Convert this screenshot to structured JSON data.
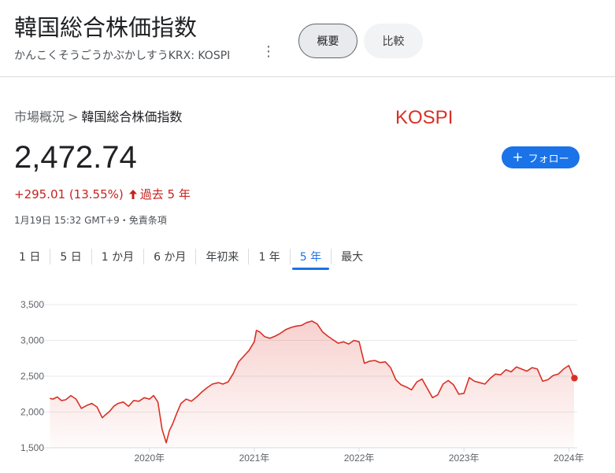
{
  "header": {
    "title": "韓国総合株価指数",
    "subtitle": "かんこくそうごうかぶかしすうKRX: KOSPI",
    "more_icon": "⋮",
    "chips": {
      "overview": "概要",
      "compare": "比較"
    }
  },
  "breadcrumb": {
    "parent": "市場概況",
    "separator": ">",
    "current": "韓国総合株価指数"
  },
  "ticker_label": "KOSPI",
  "quote": {
    "price": "2,472.74",
    "change": "+295.01 (13.55%)",
    "period": "過去 5 年",
    "meta": "1月19日 15:32 GMT+9・免責条項",
    "follow_label": "フォロー",
    "follow_icon": "+"
  },
  "ranges": [
    "1 日",
    "5 日",
    "1 か月",
    "6 か月",
    "年初来",
    "1 年",
    "5 年",
    "最大"
  ],
  "active_range": "5 年",
  "colors": {
    "line": "#d93025",
    "accent": "#1a73e8",
    "negative": "#c5221f"
  },
  "chart_data": {
    "type": "area",
    "y_ticks": [
      "3,500",
      "3,000",
      "2,500",
      "2,000",
      "1,500"
    ],
    "y_tick_values": [
      3500,
      3000,
      2500,
      2000,
      1500
    ],
    "x_ticks": [
      "2020年",
      "2021年",
      "2022年",
      "2023年",
      "2024年"
    ],
    "x_tick_values": [
      2020.0,
      2021.0,
      2022.0,
      2023.0,
      2024.0
    ],
    "ylim": [
      1500,
      3500
    ],
    "xlim": [
      2019.04,
      2024.08
    ],
    "grid": true,
    "series": [
      {
        "x": [
          2019.05,
          2019.08,
          2019.12,
          2019.16,
          2019.2,
          2019.25,
          2019.3,
          2019.35,
          2019.4,
          2019.45,
          2019.5,
          2019.55,
          2019.58,
          2019.62,
          2019.66,
          2019.7,
          2019.75,
          2019.8,
          2019.85,
          2019.9,
          2019.95,
          2020.0,
          2020.04,
          2020.08,
          2020.12,
          2020.16,
          2020.19,
          2020.22,
          2020.26,
          2020.3,
          2020.35,
          2020.4,
          2020.45,
          2020.5,
          2020.55,
          2020.6,
          2020.66,
          2020.7,
          2020.75,
          2020.8,
          2020.85,
          2020.9,
          2020.95,
          2021.0,
          2021.02,
          2021.05,
          2021.1,
          2021.15,
          2021.2,
          2021.25,
          2021.3,
          2021.35,
          2021.4,
          2021.45,
          2021.5,
          2021.55,
          2021.6,
          2021.65,
          2021.7,
          2021.75,
          2021.8,
          2021.85,
          2021.9,
          2021.95,
          2022.0,
          2022.05,
          2022.1,
          2022.15,
          2022.2,
          2022.25,
          2022.3,
          2022.35,
          2022.4,
          2022.45,
          2022.5,
          2022.55,
          2022.6,
          2022.65,
          2022.7,
          2022.75,
          2022.8,
          2022.85,
          2022.9,
          2022.95,
          2023.0,
          2023.05,
          2023.1,
          2023.15,
          2023.2,
          2023.25,
          2023.3,
          2023.35,
          2023.4,
          2023.45,
          2023.5,
          2023.55,
          2023.6,
          2023.65,
          2023.7,
          2023.75,
          2023.8,
          2023.85,
          2023.9,
          2023.95,
          2024.0,
          2024.02,
          2024.05
        ],
        "y": [
          2190,
          2180,
          2210,
          2160,
          2170,
          2230,
          2180,
          2050,
          2090,
          2120,
          2070,
          1920,
          1960,
          2010,
          2080,
          2120,
          2140,
          2080,
          2160,
          2150,
          2200,
          2180,
          2230,
          2140,
          1760,
          1570,
          1740,
          1830,
          1980,
          2120,
          2180,
          2150,
          2210,
          2280,
          2340,
          2390,
          2410,
          2390,
          2420,
          2540,
          2700,
          2780,
          2860,
          2980,
          3140,
          3120,
          3050,
          3030,
          3060,
          3100,
          3150,
          3180,
          3200,
          3210,
          3250,
          3270,
          3230,
          3120,
          3060,
          3010,
          2960,
          2980,
          2950,
          3000,
          2980,
          2680,
          2710,
          2720,
          2690,
          2700,
          2620,
          2450,
          2380,
          2350,
          2310,
          2420,
          2460,
          2330,
          2200,
          2240,
          2390,
          2440,
          2380,
          2250,
          2260,
          2480,
          2430,
          2410,
          2390,
          2470,
          2530,
          2520,
          2590,
          2560,
          2630,
          2600,
          2570,
          2620,
          2600,
          2430,
          2450,
          2510,
          2530,
          2600,
          2650,
          2580,
          2472.74
        ]
      }
    ]
  }
}
